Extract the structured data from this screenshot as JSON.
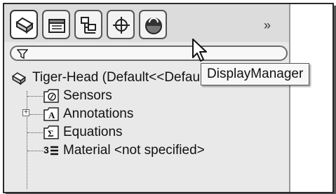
{
  "tabs": [
    {
      "name": "FeatureManager",
      "icon": "part-icon"
    },
    {
      "name": "PropertyManager",
      "icon": "property-icon"
    },
    {
      "name": "ConfigurationManager",
      "icon": "configuration-icon"
    },
    {
      "name": "DimXpertManager",
      "icon": "target-icon"
    },
    {
      "name": "DisplayManager",
      "icon": "display-manager-icon"
    }
  ],
  "more_tabs_symbol": "»",
  "tooltip": {
    "text": "DisplayManager"
  },
  "tree": {
    "root": {
      "label": "Tiger-Head  (Default<<Default>_",
      "icon": "part-icon"
    },
    "items": [
      {
        "label": "Sensors",
        "icon": "sensor-icon"
      },
      {
        "label": "Annotations",
        "icon": "annotation-icon",
        "expander": "+"
      },
      {
        "label": "Equations",
        "icon": "equation-icon"
      },
      {
        "label": "Material <not specified>",
        "icon": "material-icon"
      }
    ]
  },
  "colors": {
    "panel_bg": "#e9e9e9",
    "tab_border": "#555555",
    "tooltip_bg": "#f7f7f7"
  }
}
